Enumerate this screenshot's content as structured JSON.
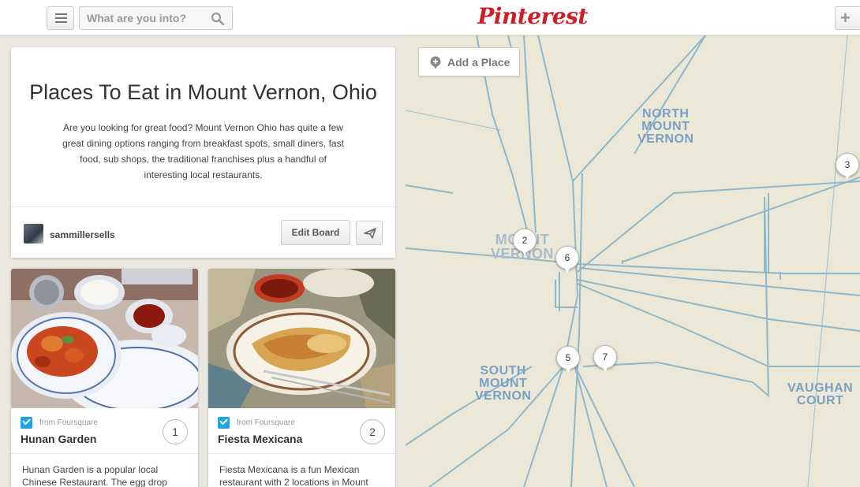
{
  "header": {
    "search_placeholder": "What are you into?",
    "logo": "Pinterest",
    "menu_icon": "menu-icon",
    "search_icon": "search-icon",
    "plus_icon": "plus-icon",
    "plus_glyph": "+"
  },
  "board": {
    "title": "Places To Eat in Mount Vernon, Ohio",
    "description": "Are you looking for great food? Mount Vernon Ohio has quite a few great dining options ranging from breakfast spots, small diners, fast food, sub shops, the traditional franchises plus a handful of interesting local restaurants.",
    "username": "sammillersells",
    "edit_label": "Edit Board",
    "send_icon": "send-icon"
  },
  "pins": [
    {
      "source": "from Foursquare",
      "name": "Hunan Garden",
      "number": "1",
      "description": "Hunan Garden is a popular local Chinese Restaurant. The egg drop"
    },
    {
      "source": "from Foursquare",
      "name": "Fiesta Mexicana",
      "number": "2",
      "description": "Fiesta Mexicana is a fun Mexican restaurant with 2 locations in Mount"
    }
  ],
  "map": {
    "add_place_label": "Add a Place",
    "labels": {
      "north_1": "NORTH",
      "north_2": "MOUNT",
      "north_3": "VERNON",
      "center_1": "MOUNT",
      "center_2": "VERNON",
      "south_1": "SOUTH",
      "south_2": "MOUNT",
      "south_3": "VERNON",
      "vaughan_1": "VAUGHAN",
      "vaughan_2": "COURT"
    },
    "markers": [
      "2",
      "6",
      "3",
      "5",
      "7"
    ],
    "colors": {
      "road": "#8fb7c9",
      "label": "#7a9fc4",
      "land": "#ece8d8"
    }
  }
}
